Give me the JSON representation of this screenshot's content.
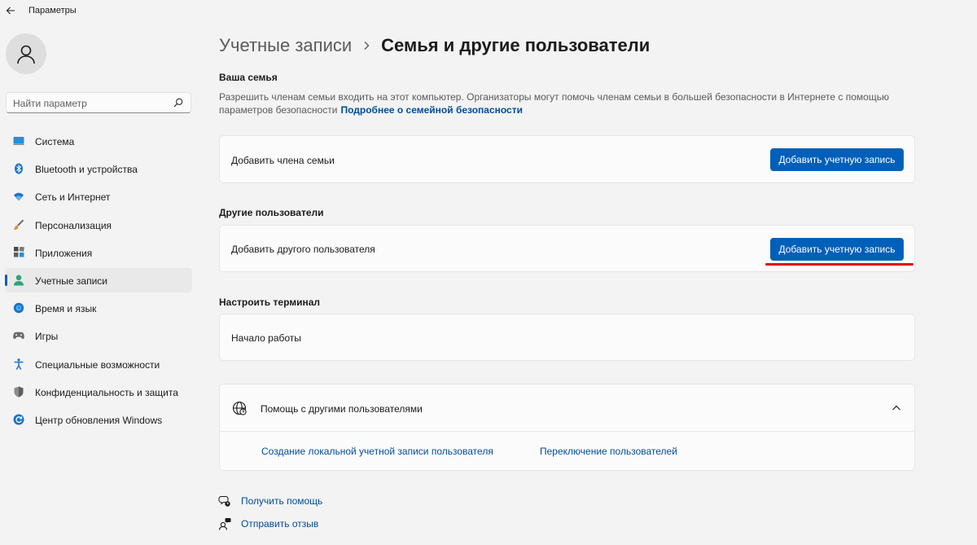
{
  "window": {
    "title": "Параметры"
  },
  "sidebar": {
    "search_placeholder": "Найти параметр",
    "items": [
      {
        "label": "Система",
        "icon": "monitor-icon"
      },
      {
        "label": "Bluetooth и устройства",
        "icon": "bluetooth-icon"
      },
      {
        "label": "Сеть и Интернет",
        "icon": "wifi-icon"
      },
      {
        "label": "Персонализация",
        "icon": "brush-icon"
      },
      {
        "label": "Приложения",
        "icon": "apps-icon"
      },
      {
        "label": "Учетные записи",
        "icon": "user-icon",
        "active": true
      },
      {
        "label": "Время и язык",
        "icon": "globe-clock-icon"
      },
      {
        "label": "Игры",
        "icon": "gamepad-icon"
      },
      {
        "label": "Специальные возможности",
        "icon": "accessibility-icon"
      },
      {
        "label": "Конфиденциальность и защита",
        "icon": "shield-icon"
      },
      {
        "label": "Центр обновления Windows",
        "icon": "update-icon"
      }
    ]
  },
  "breadcrumb": {
    "parent": "Учетные записи",
    "current": "Семья и другие пользователи"
  },
  "family": {
    "title": "Ваша семья",
    "description": "Разрешить членам семьи входить на этот компьютер. Организаторы могут помочь членам семьи в большей безопасности в Интернете с помощью параметров безопасности",
    "link": "Подробнее о семейной безопасности",
    "card_label": "Добавить члена семьи",
    "button": "Добавить учетную запись"
  },
  "others": {
    "title": "Другие пользователи",
    "card_label": "Добавить другого пользователя",
    "button": "Добавить учетную запись"
  },
  "kiosk": {
    "title": "Настроить терминал",
    "card_label": "Начало работы"
  },
  "help": {
    "title": "Помощь с другими пользователями",
    "links": [
      "Создание локальной учетной записи пользователя",
      "Переключение пользователей"
    ]
  },
  "footer": {
    "get_help": "Получить помощь",
    "feedback": "Отправить отзыв"
  },
  "colors": {
    "accent": "#005fb8",
    "highlight": "#e0001b",
    "link": "#004c99"
  }
}
